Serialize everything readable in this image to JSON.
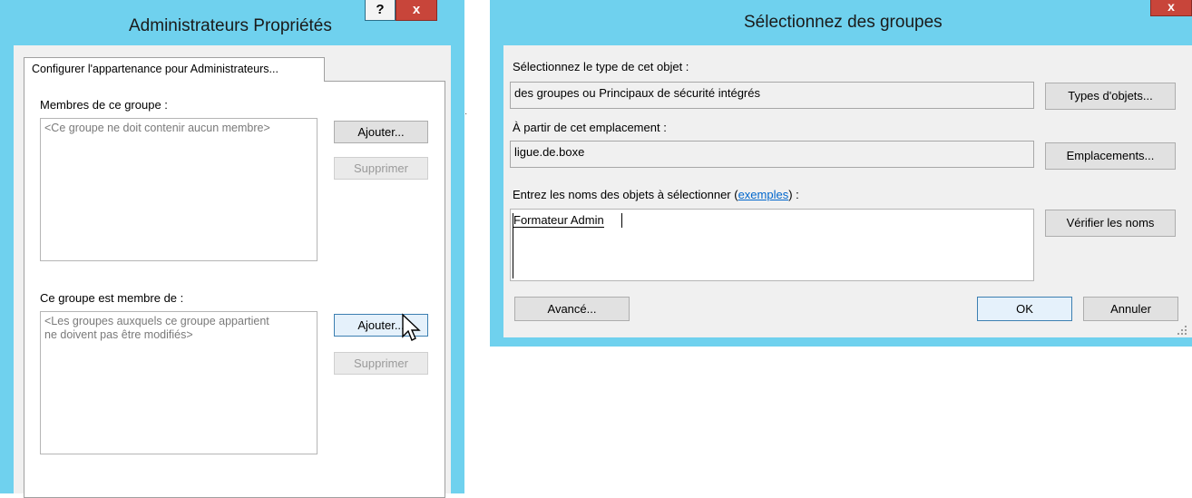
{
  "left_window": {
    "title": "Administrateurs Propriétés",
    "help_label": "?",
    "close_label": "x",
    "tab_label": "Configurer l'appartenance pour Administrateurs...",
    "members_label": "Membres de ce groupe :",
    "members_placeholder": "<Ce groupe ne doit contenir aucun membre>",
    "member_of_label": "Ce groupe est membre de :",
    "member_of_line1": "<Les groupes auxquels ce groupe appartient",
    "member_of_line2": "ne doivent pas être modifiés>",
    "add_label": "Ajouter...",
    "remove_label": "Supprimer"
  },
  "right_window": {
    "title": "Sélectionnez des groupes",
    "close_label": "x",
    "type_label": "Sélectionnez le type de cet objet :",
    "type_value": "des groupes ou Principaux de sécurité intégrés",
    "object_types_button": "Types d'objets...",
    "location_label": "À partir de cet emplacement :",
    "location_value": "ligue.de.boxe",
    "locations_button": "Emplacements...",
    "names_label_prefix": "Entrez les noms des objets à sélectionner (",
    "names_label_link": "exemples",
    "names_label_suffix": ") :",
    "names_value": "Formateur Admin",
    "check_names_button": "Vérifier les noms",
    "advanced_button": "Avancé...",
    "ok_button": "OK",
    "cancel_button": "Annuler"
  },
  "colors": {
    "title_bar": "#6fd1ee",
    "close_button": "#c8453a",
    "link": "#0066cc"
  }
}
